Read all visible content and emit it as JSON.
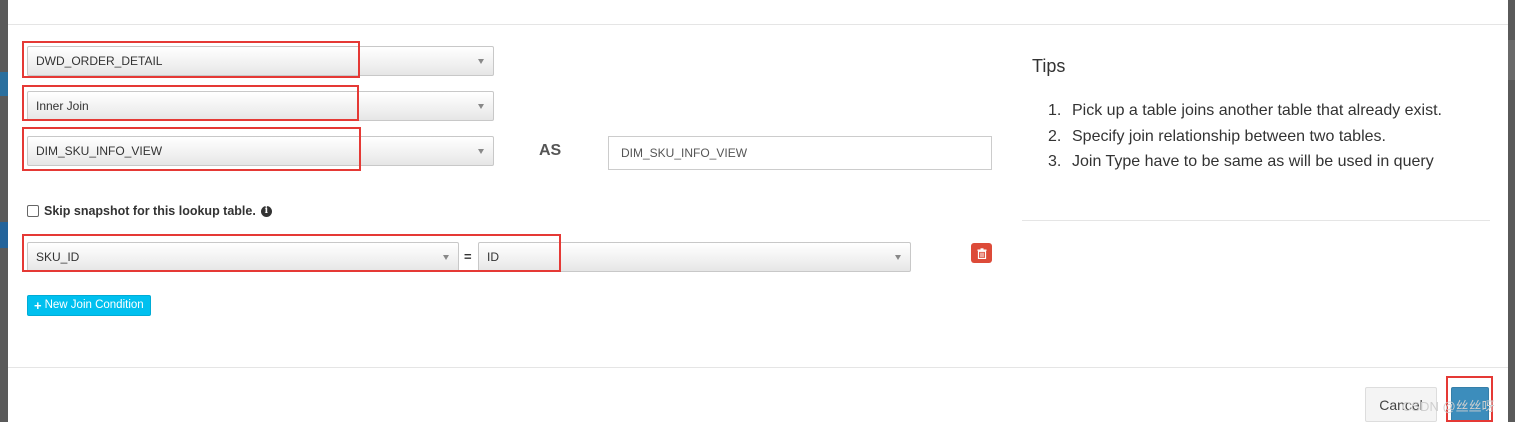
{
  "join_form": {
    "left_table": "DWD_ORDER_DETAIL",
    "join_type": "Inner Join",
    "lookup_table": "DIM_SKU_INFO_VIEW",
    "as_label": "AS",
    "alias_value": "DIM_SKU_INFO_VIEW",
    "skip_snapshot_label": "Skip snapshot for this lookup table.",
    "skip_snapshot_checked": false,
    "conditions": [
      {
        "left_column": "SKU_ID",
        "operator": "=",
        "right_column": "ID"
      }
    ],
    "new_condition_label": "New Join Condition"
  },
  "tips": {
    "title": "Tips",
    "items": [
      {
        "num": "1.",
        "text": "Pick up a table joins another table that already exist."
      },
      {
        "num": "2.",
        "text": "Specify join relationship between two tables."
      },
      {
        "num": "3.",
        "text": "Join Type have to be same as will be used in query"
      }
    ]
  },
  "footer": {
    "cancel_label": "Cancel",
    "ok_label": "",
    "watermark": "CSDN @丝丝呀"
  },
  "colors": {
    "highlight": "#e53935",
    "info_button": "#00c0ef",
    "danger": "#dd4b39",
    "primary": "#3c8dbc"
  }
}
